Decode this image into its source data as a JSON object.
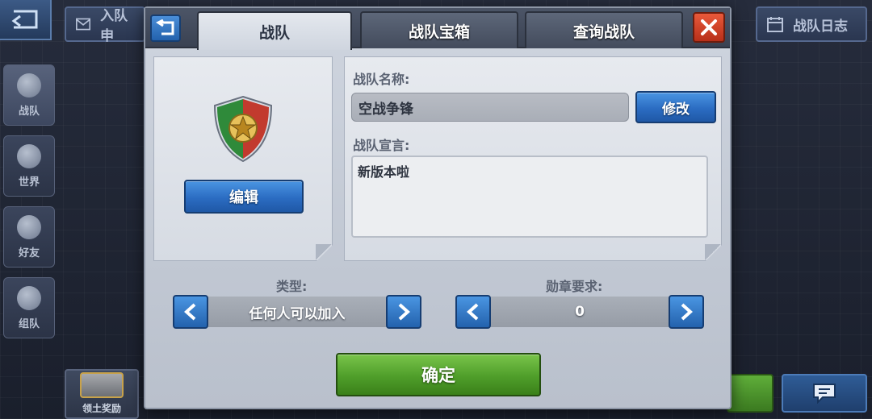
{
  "background": {
    "top_buttons": [
      {
        "label": "入队申",
        "icon": "envelope-icon"
      },
      {
        "label": "战队日志",
        "icon": "calendar-icon"
      }
    ],
    "side_nav": [
      {
        "label": "战队",
        "icon": "shield-icon",
        "active": true
      },
      {
        "label": "世界",
        "icon": "globe-icon",
        "active": false
      },
      {
        "label": "好友",
        "icon": "friends-icon",
        "active": false
      },
      {
        "label": "组队",
        "icon": "plane-icon",
        "active": false
      }
    ],
    "bottom": {
      "reward_label": "领土奖励",
      "chat_icon": "chat-icon"
    }
  },
  "dialog": {
    "tabs": [
      {
        "label": "战队",
        "active": true
      },
      {
        "label": "战队宝箱",
        "active": false
      },
      {
        "label": "查询战队",
        "active": false
      }
    ],
    "back_icon": "back-arrow-icon",
    "close_icon": "close-icon",
    "emblem": {
      "icon": "star-shield-emblem",
      "colors": {
        "left": "#2f8a3a",
        "right": "#c23a2e",
        "star": "#e6b93a"
      }
    },
    "edit_label": "编辑",
    "name": {
      "label": "战队名称:",
      "value": "空战争锋",
      "modify_label": "修改"
    },
    "declaration": {
      "label": "战队宣言:",
      "value": "新版本啦"
    },
    "type_selector": {
      "label": "类型:",
      "value": "任何人可以加入"
    },
    "medal_selector": {
      "label": "勋章要求:",
      "value": "0"
    },
    "confirm_label": "确定"
  },
  "colors": {
    "accent_blue": "#2b6cc2",
    "confirm_green": "#4f9e2a",
    "close_red": "#c8391f"
  }
}
